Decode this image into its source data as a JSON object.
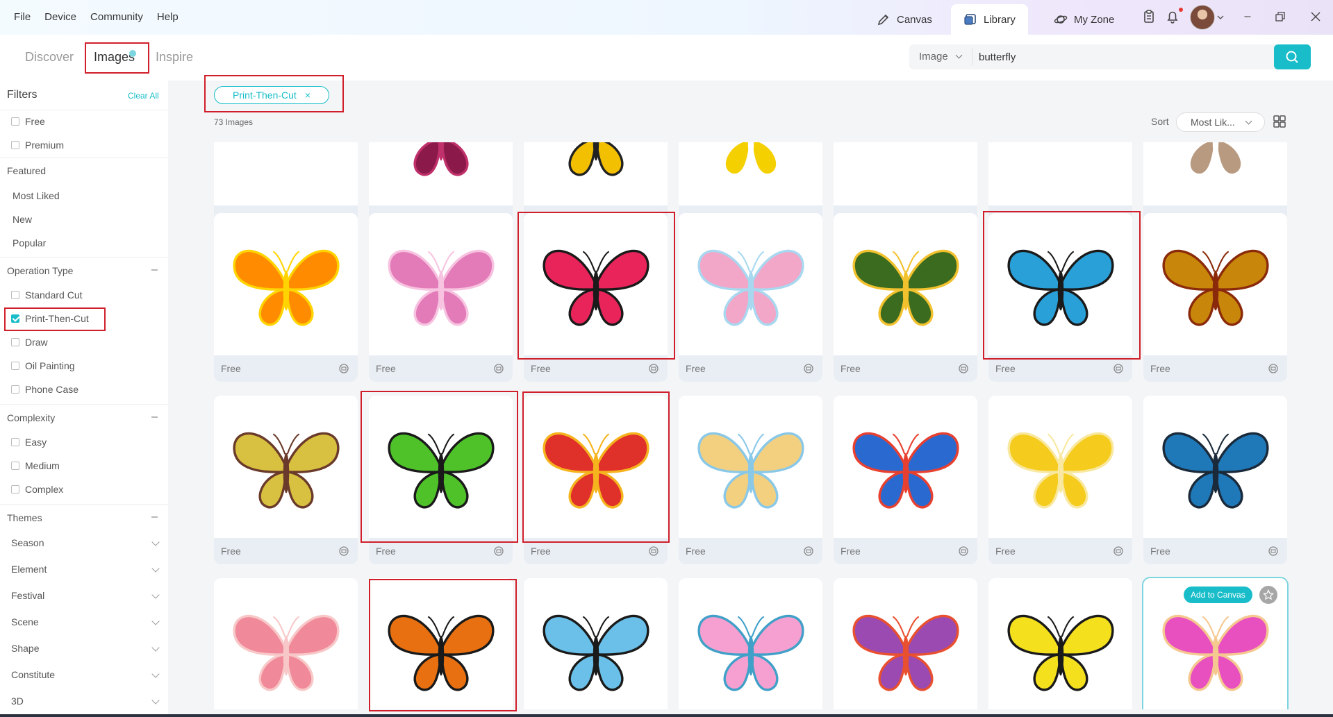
{
  "menu": [
    "File",
    "Device",
    "Community",
    "Help"
  ],
  "nav_tabs": [
    {
      "label": "Canvas",
      "icon": "canvas-icon"
    },
    {
      "label": "Library",
      "icon": "library-icon"
    },
    {
      "label": "My Zone",
      "icon": "planet-icon"
    }
  ],
  "subtabs": [
    "Discover",
    "Images",
    "Inspire"
  ],
  "search": {
    "type": "Image",
    "value": "butterfly",
    "placeholder": ""
  },
  "sidebar": {
    "title": "Filters",
    "clear_all": "Clear All",
    "price": [
      "Free",
      "Premium"
    ],
    "featured_title": "Featured",
    "featured": [
      "Most Liked",
      "New",
      "Popular"
    ],
    "operation_title": "Operation Type",
    "operation": [
      "Standard Cut",
      "Print-Then-Cut",
      "Draw",
      "Oil Painting",
      "Phone Case"
    ],
    "complexity_title": "Complexity",
    "complexity": [
      "Easy",
      "Medium",
      "Complex"
    ],
    "themes_title": "Themes",
    "themes": [
      "Season",
      "Element",
      "Festival",
      "Scene",
      "Shape",
      "Constitute",
      "3D"
    ],
    "collapse_symbol": "–"
  },
  "filter_chip": {
    "label": "Print-Then-Cut",
    "close": "×"
  },
  "result_count": "73 Images",
  "sort": {
    "label": "Sort",
    "value": "Most Lik..."
  },
  "card_label": "Free",
  "add_to_canvas": "Add to Canvas",
  "colors": {
    "accent": "#18bdc9",
    "annotation": "#d01f2a",
    "footer": "#e9eef5"
  },
  "cards": [
    {
      "name": "butterfly-partial-1",
      "colors": [
        "#ffffff",
        "#ffffff"
      ],
      "show_label": true
    },
    {
      "name": "butterfly-partial-purple",
      "colors": [
        "#8b1a4a",
        "#c0306a"
      ],
      "show_label": true
    },
    {
      "name": "butterfly-partial-yellow",
      "colors": [
        "#f2c000",
        "#222222"
      ],
      "show_label": true
    },
    {
      "name": "butterfly-partial-4",
      "colors": [
        "#f5d000",
        "#ffffff"
      ],
      "show_label": true
    },
    {
      "name": "butterfly-partial-5",
      "colors": [
        "#ffffff",
        "#ffffff"
      ],
      "show_label": true
    },
    {
      "name": "butterfly-partial-6",
      "colors": [
        "#ffffff",
        "#ffffff"
      ],
      "show_label": true
    },
    {
      "name": "butterfly-partial-lace",
      "colors": [
        "#b89a80",
        "#ffffff"
      ],
      "show_label": true
    },
    {
      "name": "butterfly-orange-gradient",
      "colors": [
        "#ff8c00",
        "#ffd400"
      ],
      "show_label": true
    },
    {
      "name": "butterfly-pink-lace",
      "colors": [
        "#e27bb8",
        "#f7c3e0"
      ],
      "show_label": true
    },
    {
      "name": "butterfly-red-black",
      "colors": [
        "#e8245a",
        "#1a1a1a"
      ],
      "show_label": true
    },
    {
      "name": "butterfly-rainbow-lace",
      "colors": [
        "#f2a6c8",
        "#a8d8f0"
      ],
      "show_label": true
    },
    {
      "name": "butterfly-flower-pattern",
      "colors": [
        "#3a6b1e",
        "#f2c12e"
      ],
      "show_label": true
    },
    {
      "name": "butterfly-blue-black",
      "colors": [
        "#2aa0d8",
        "#1a1a1a"
      ],
      "show_label": true
    },
    {
      "name": "butterfly-gold-filigree",
      "colors": [
        "#c8860a",
        "#8a2a0a"
      ],
      "show_label": true
    },
    {
      "name": "butterfly-swallowtail-yellow",
      "colors": [
        "#d8c040",
        "#6a3a2a"
      ],
      "show_label": true
    },
    {
      "name": "butterfly-green-black",
      "colors": [
        "#4fc22a",
        "#1a1a1a"
      ],
      "show_label": true
    },
    {
      "name": "butterfly-red-yellow",
      "colors": [
        "#e0302a",
        "#f5b41e"
      ],
      "show_label": true
    },
    {
      "name": "butterfly-stickers",
      "colors": [
        "#f2d080",
        "#8ac8e8"
      ],
      "show_label": true
    },
    {
      "name": "butterfly-blue-patterned",
      "colors": [
        "#2a6ad0",
        "#e84030"
      ],
      "show_label": true
    },
    {
      "name": "butterfly-yellow-silhouettes",
      "colors": [
        "#f5cc1e",
        "#f8e8a0"
      ],
      "show_label": true
    },
    {
      "name": "butterfly-blue-dark",
      "colors": [
        "#1f78b8",
        "#1a2a3a"
      ],
      "show_label": true
    },
    {
      "name": "butterfly-pink-roses",
      "colors": [
        "#f08a9a",
        "#f8c8c8"
      ],
      "show_label": false
    },
    {
      "name": "butterfly-orange-black",
      "colors": [
        "#e87010",
        "#1a1a1a"
      ],
      "show_label": false
    },
    {
      "name": "butterfly-small-blue",
      "colors": [
        "#6ac0e8",
        "#1a1a1a"
      ],
      "show_label": false
    },
    {
      "name": "butterfly-pink-closeup",
      "colors": [
        "#f5a0d0",
        "#40a0c8"
      ],
      "show_label": false
    },
    {
      "name": "butterfly-swirl-purple",
      "colors": [
        "#9a4ab0",
        "#e85030"
      ],
      "show_label": false
    },
    {
      "name": "butterfly-swallowtail-black-yellow",
      "colors": [
        "#f5e01e",
        "#1a1a1a"
      ],
      "show_label": false
    },
    {
      "name": "butterfly-pink-gradient-hover",
      "colors": [
        "#e850c0",
        "#f5c890"
      ],
      "show_label": false,
      "hover": true
    }
  ]
}
